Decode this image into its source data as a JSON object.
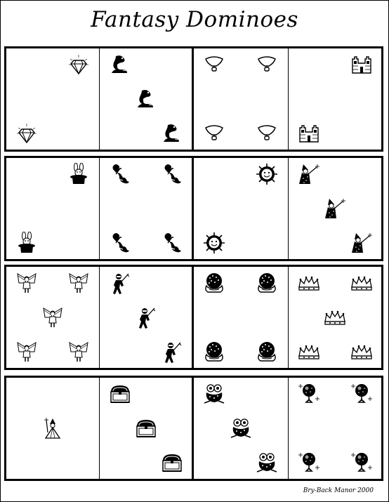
{
  "title": "Fantasy Dominoes",
  "credit": "Bry-Back Manor 2000",
  "rows": [
    {
      "dominoes": [
        {
          "left": {
            "icon": "diamond-icon",
            "count": 2
          },
          "right": {
            "icon": "dragon-icon",
            "count": 3
          }
        },
        {
          "left": {
            "icon": "balloon-icon",
            "count": 4
          },
          "right": {
            "icon": "castle-icon",
            "count": 2
          }
        }
      ]
    },
    {
      "dominoes": [
        {
          "left": {
            "icon": "rabbit-hat-icon",
            "count": 2
          },
          "right": {
            "icon": "mermaid-icon",
            "count": 4
          }
        },
        {
          "left": {
            "icon": "sun-face-icon",
            "count": 2
          },
          "right": {
            "icon": "wizard-icon",
            "count": 3
          }
        }
      ]
    },
    {
      "dominoes": [
        {
          "left": {
            "icon": "fairy-icon",
            "count": 5
          },
          "right": {
            "icon": "ninja-icon",
            "count": 3
          }
        },
        {
          "left": {
            "icon": "crystal-ball-icon",
            "count": 4
          },
          "right": {
            "icon": "crown-icon",
            "count": 5
          }
        }
      ]
    },
    {
      "dominoes": [
        {
          "left": {
            "icon": "sorcerer-icon",
            "count": 1
          },
          "right": {
            "icon": "treasure-chest-icon",
            "count": 3
          }
        },
        {
          "left": {
            "icon": "frog-icon",
            "count": 3
          },
          "right": {
            "icon": "magic-orb-icon",
            "count": 4
          }
        }
      ]
    }
  ]
}
